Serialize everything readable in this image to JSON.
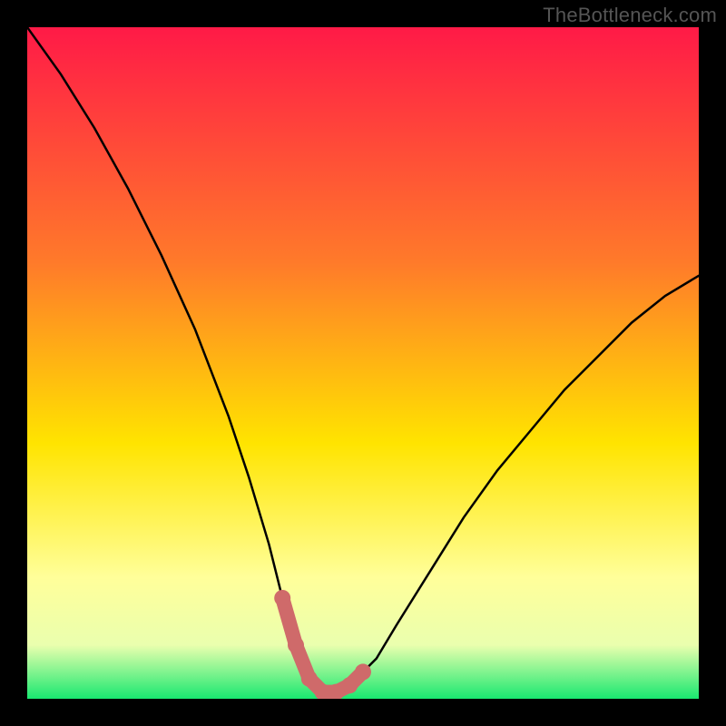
{
  "watermark": "TheBottleneck.com",
  "colors": {
    "frame": "#000000",
    "curve": "#000000",
    "marker": "#cf6a6a",
    "gradient_top": "#ff1a47",
    "gradient_mid_upper": "#ff7a2a",
    "gradient_mid": "#ffe400",
    "gradient_mid_lower": "#ffff9a",
    "gradient_lower": "#eaffae",
    "gradient_bottom": "#19e870"
  },
  "chart_data": {
    "type": "line",
    "title": "",
    "xlabel": "",
    "ylabel": "",
    "xlim": [
      0,
      100
    ],
    "ylim": [
      0,
      100
    ],
    "series": [
      {
        "name": "bottleneck-curve",
        "x": [
          0,
          5,
          10,
          15,
          20,
          25,
          30,
          33,
          36,
          38,
          40,
          42,
          44,
          46,
          48,
          52,
          55,
          60,
          65,
          70,
          75,
          80,
          85,
          90,
          95,
          100
        ],
        "values": [
          100,
          93,
          85,
          76,
          66,
          55,
          42,
          33,
          23,
          15,
          8,
          3,
          1,
          1,
          2,
          6,
          11,
          19,
          27,
          34,
          40,
          46,
          51,
          56,
          60,
          63
        ]
      }
    ],
    "markers": {
      "name": "highlight-dots",
      "x": [
        38,
        40,
        42,
        44,
        46,
        48,
        50
      ],
      "values": [
        15,
        8,
        3,
        1,
        1,
        2,
        4
      ]
    }
  }
}
